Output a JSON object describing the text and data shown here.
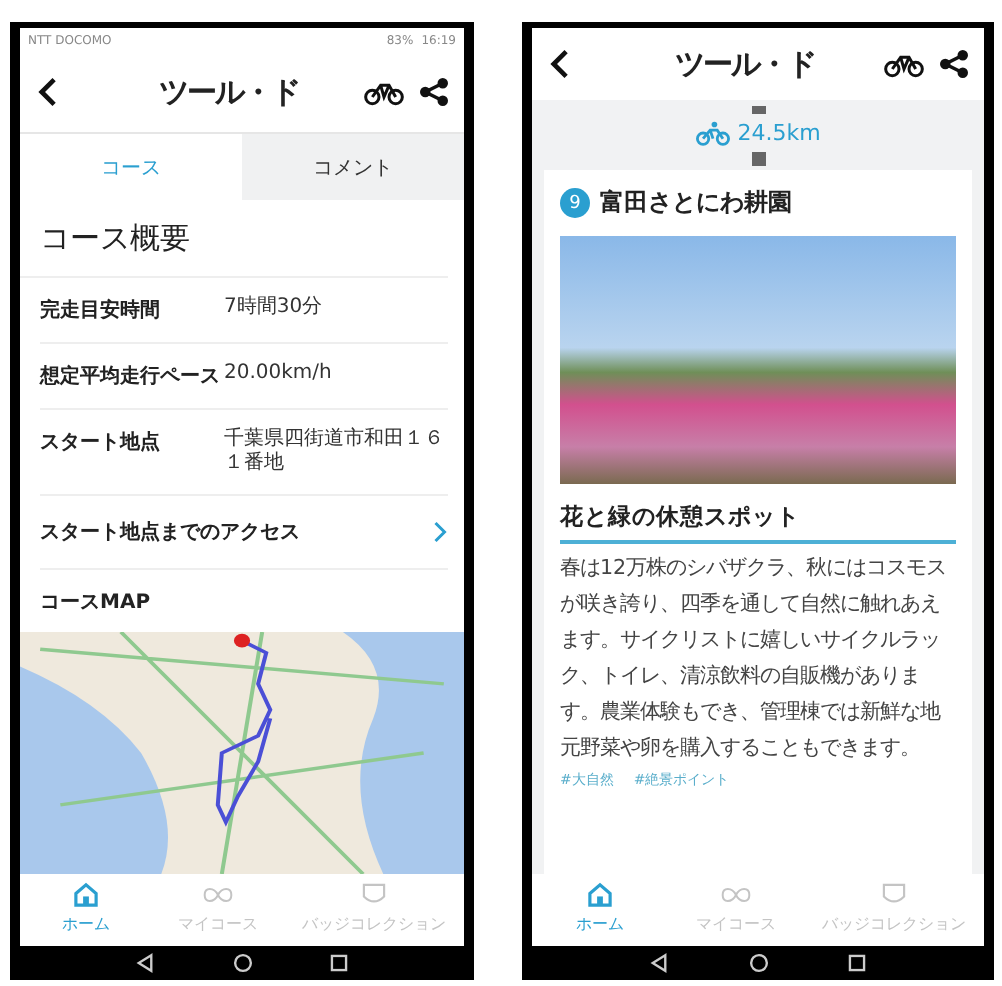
{
  "left_screen": {
    "status_bar": {
      "carrier": "NTT DOCOMO",
      "battery": "83%",
      "time": "16:19"
    },
    "header": {
      "title": "ツール・ド"
    },
    "tabs": [
      {
        "label": "コース",
        "selected": true
      },
      {
        "label": "コメント",
        "selected": false
      }
    ],
    "section_title": "コース概要",
    "rows": [
      {
        "kind": "info",
        "label": "完走目安時間",
        "value": "7時間30分"
      },
      {
        "kind": "info",
        "label": "想定平均走行ペース",
        "value": "20.00km/h"
      },
      {
        "kind": "info",
        "label": "スタート地点",
        "value": "千葉県四街道市和田１６１番地"
      },
      {
        "kind": "link",
        "label": "スタート地点までのアクセス"
      },
      {
        "kind": "plain",
        "label": "コースMAP"
      }
    ],
    "bottom_nav": [
      {
        "kind": "home",
        "label": "ホーム",
        "selected": true
      },
      {
        "kind": "loop",
        "label": "マイコース",
        "selected": false
      },
      {
        "kind": "badge",
        "label": "バッジコレクション",
        "selected": false
      }
    ]
  },
  "right_screen": {
    "header": {
      "title": "ツール・ド"
    },
    "distance": "24.5km",
    "spot": {
      "number": "9",
      "name": "富田さとにわ耕園",
      "subtitle": "花と緑の休憩スポット",
      "description": "春は12万株のシバザクラ、秋にはコスモスが咲き誇り、四季を通して自然に触れあえます。サイクリストに嬉しいサイクルラック、トイレ、清涼飲料の自販機があります。農業体験もでき、管理棟では新鮮な地元野菜や卵を購入することもできます。",
      "tags": [
        "#大自然",
        "#絶景ポイント"
      ]
    },
    "bottom_nav": [
      {
        "kind": "home",
        "label": "ホーム",
        "selected": true
      },
      {
        "kind": "loop",
        "label": "マイコース",
        "selected": false
      },
      {
        "kind": "badge",
        "label": "バッジコレクション",
        "selected": false
      }
    ]
  }
}
